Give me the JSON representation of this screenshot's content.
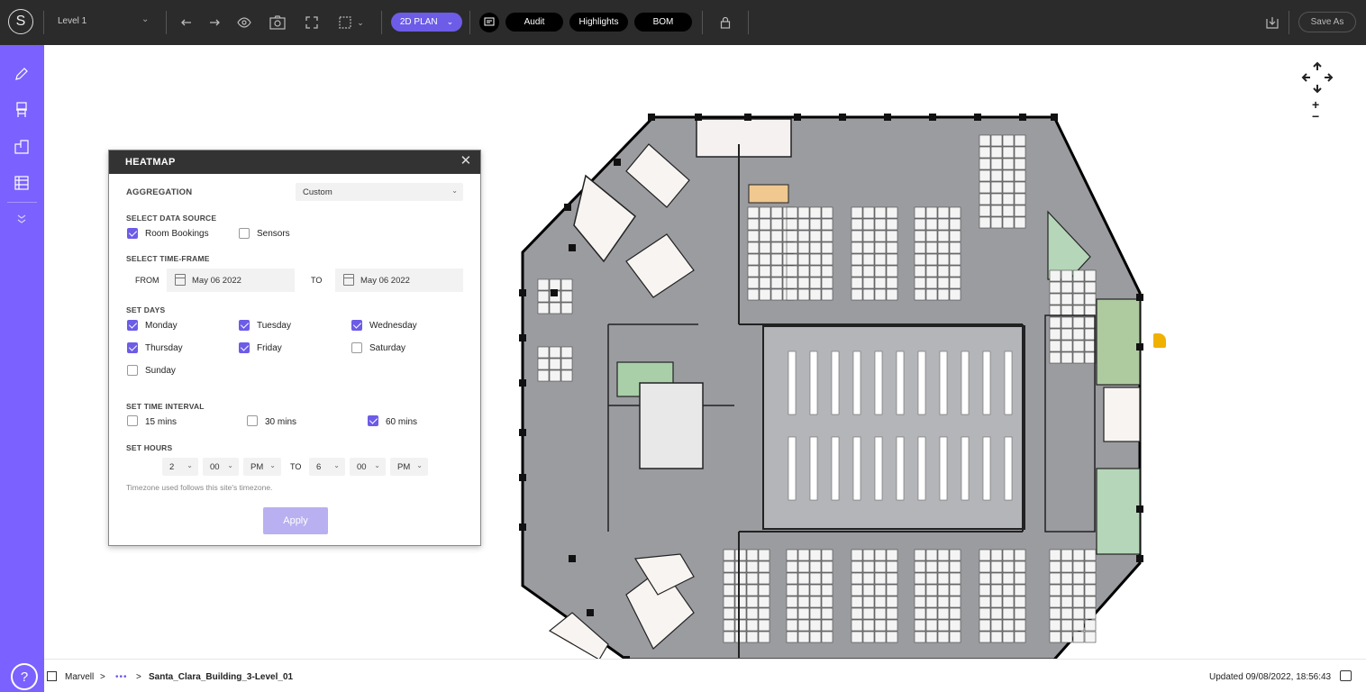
{
  "topbar": {
    "logo": "S",
    "level_select": "Level 1",
    "plan_button": "2D PLAN",
    "audit": "Audit",
    "highlights": "Highlights",
    "bom": "BOM",
    "save_as": "Save As"
  },
  "heatmap": {
    "title": "HEATMAP",
    "aggregation_label": "AGGREGATION",
    "aggregation_value": "Custom",
    "data_source_label": "SELECT DATA SOURCE",
    "sources": [
      {
        "label": "Room Bookings",
        "checked": true
      },
      {
        "label": "Sensors",
        "checked": false
      }
    ],
    "timeframe_label": "SELECT TIME-FRAME",
    "from_label": "FROM",
    "from_date": "May 06 2022",
    "to_label": "TO",
    "to_date": "May 06 2022",
    "days_label": "SET DAYS",
    "days": [
      {
        "label": "Monday",
        "checked": true
      },
      {
        "label": "Tuesday",
        "checked": true
      },
      {
        "label": "Wednesday",
        "checked": true
      },
      {
        "label": "Thursday",
        "checked": true
      },
      {
        "label": "Friday",
        "checked": true
      },
      {
        "label": "Saturday",
        "checked": false
      },
      {
        "label": "Sunday",
        "checked": false
      }
    ],
    "interval_label": "SET TIME INTERVAL",
    "intervals": [
      {
        "label": "15 mins",
        "checked": false
      },
      {
        "label": "30 mins",
        "checked": false
      },
      {
        "label": "60 mins",
        "checked": true
      }
    ],
    "hours_label": "SET HOURS",
    "hours_from": {
      "hour": "2",
      "minute": "00",
      "ampm": "PM"
    },
    "hours_to_label": "TO",
    "hours_to": {
      "hour": "6",
      "minute": "00",
      "ampm": "PM"
    },
    "timezone_note": "Timezone used follows this site's timezone.",
    "apply": "Apply"
  },
  "footer": {
    "org": "Marvell",
    "sep1": ">",
    "ellipsis": "•••",
    "sep2": ">",
    "building": "Santa_Clara_Building_3-Level_01",
    "updated": "Updated 09/08/2022, 18:56:43"
  },
  "map_controls": {
    "zoom_in": "+",
    "zoom_out": "−"
  },
  "colors": {
    "accent": "#7b61ff",
    "plan_button": "#6c5ce7",
    "topbar": "#2b2b2b",
    "apply_disabled": "#b8b0f0"
  }
}
